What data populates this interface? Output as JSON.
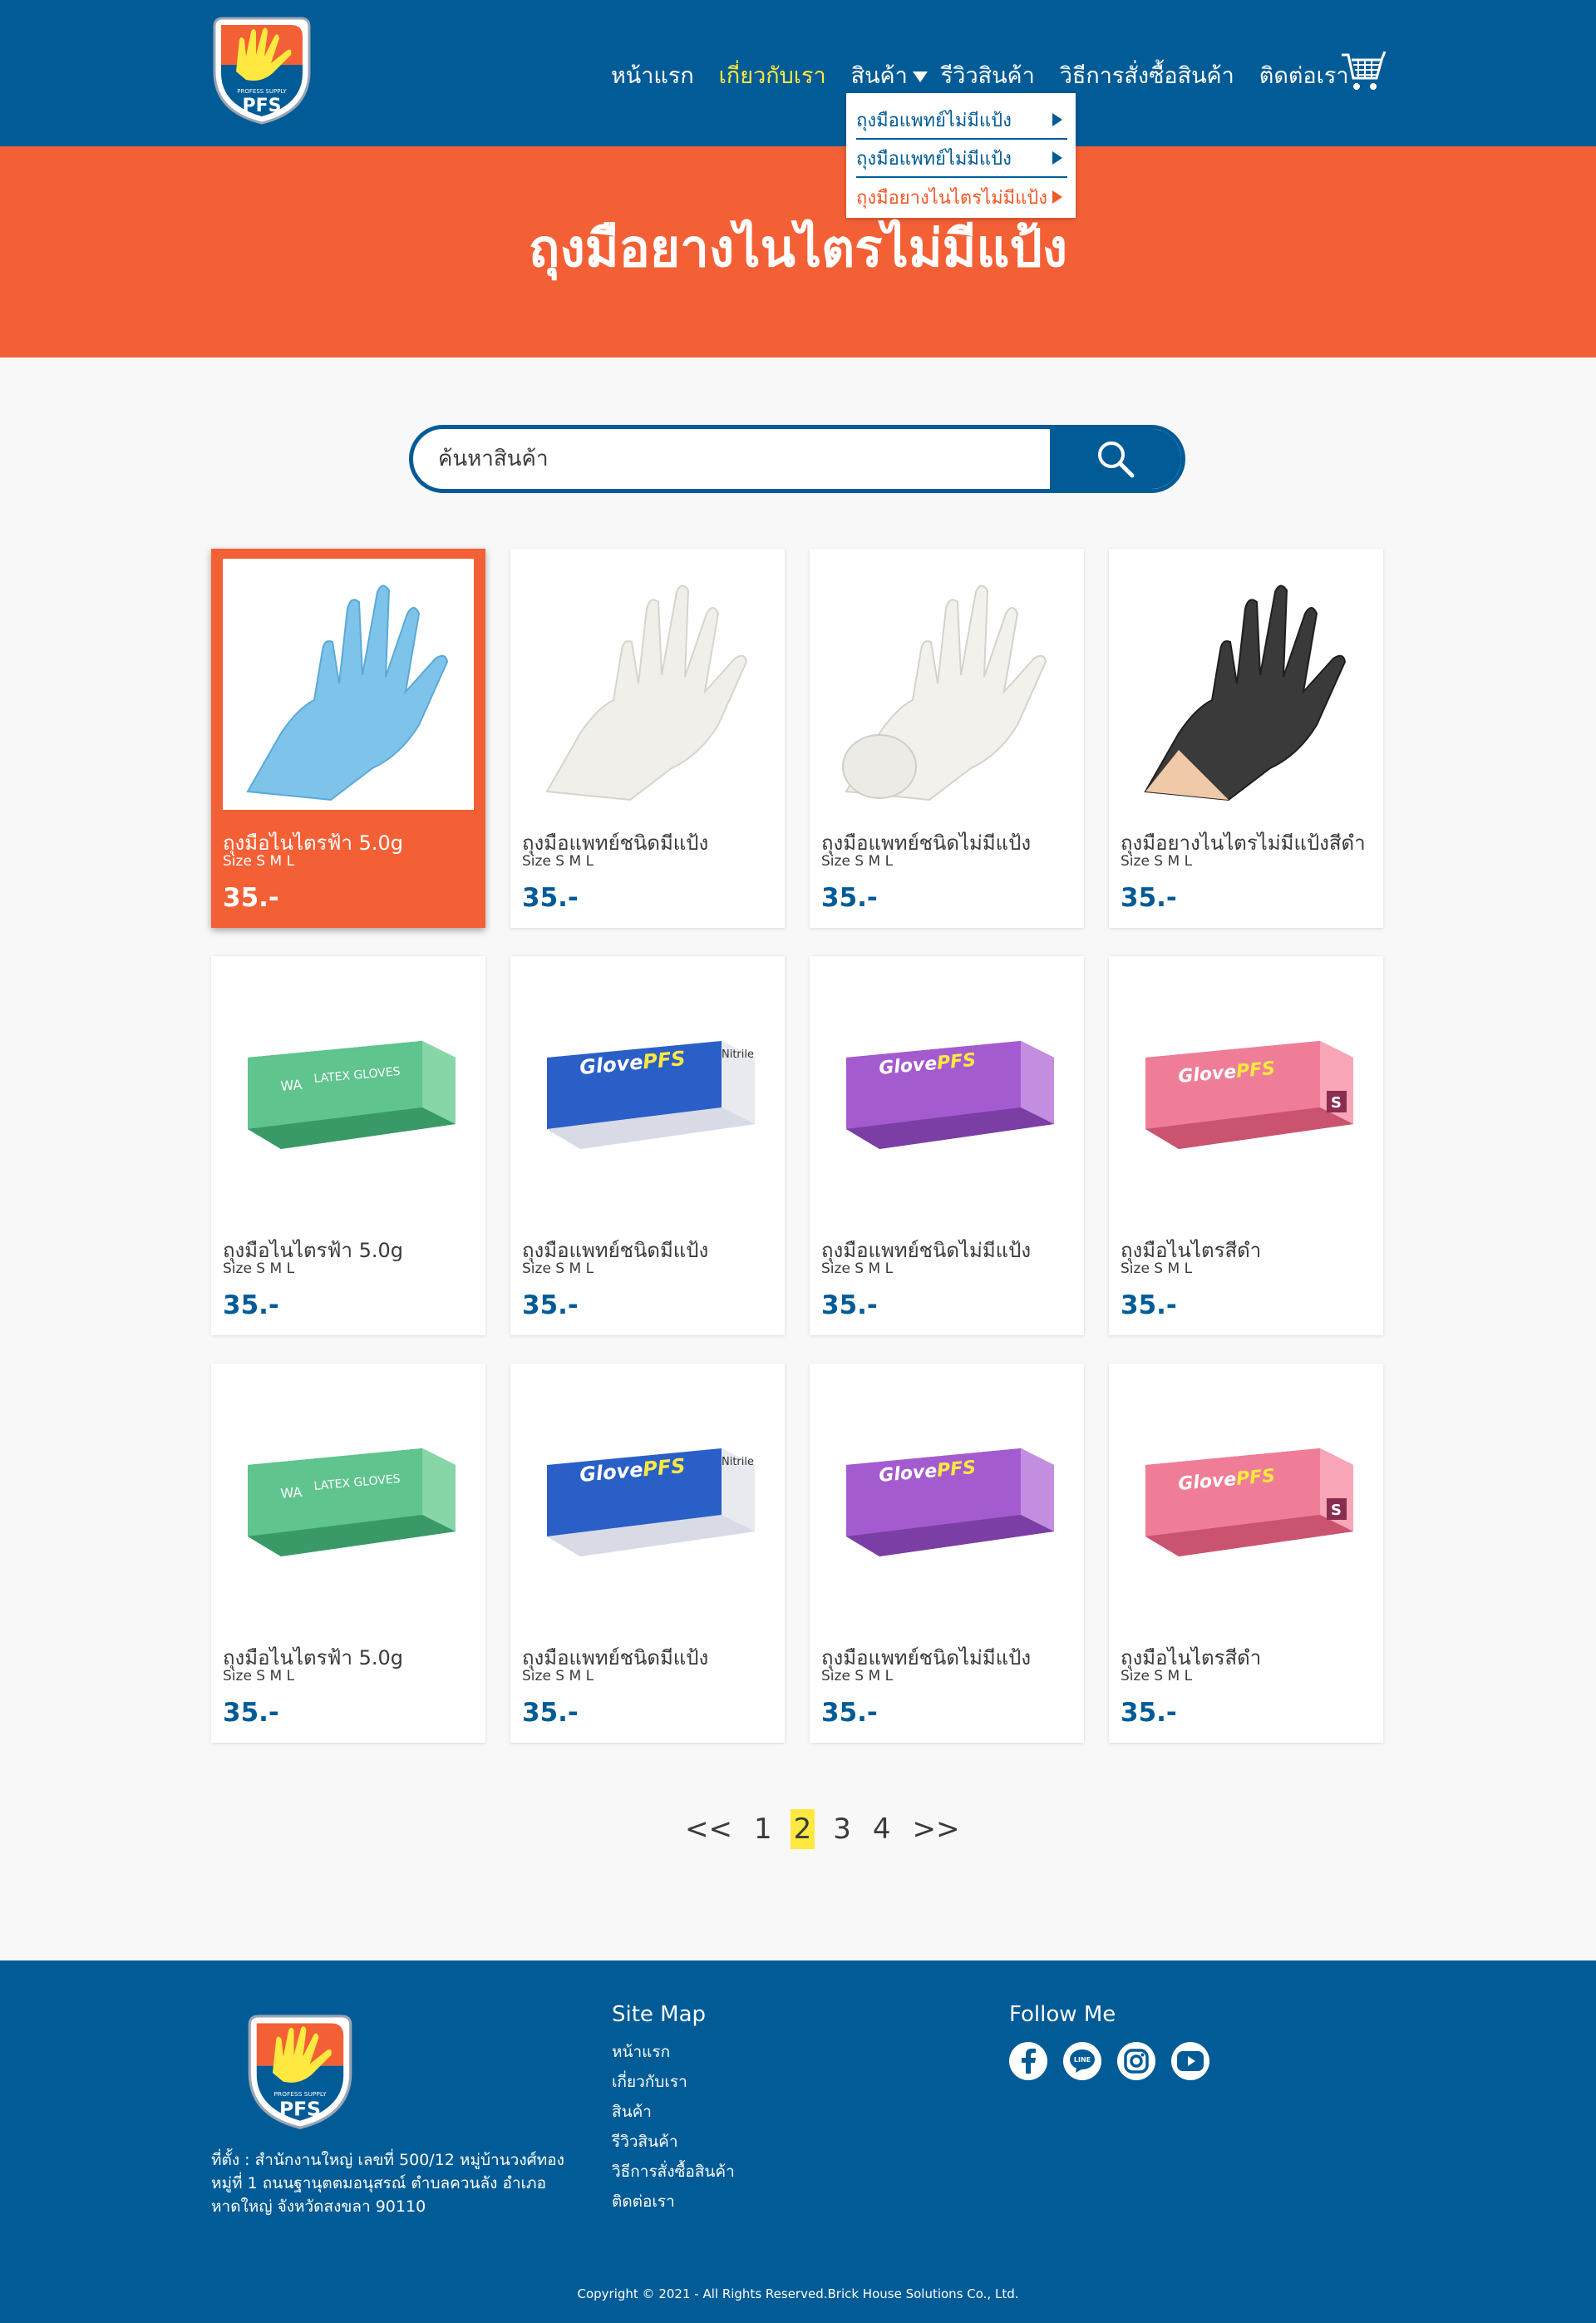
{
  "header": {
    "logo_text": "PFS",
    "logo_tagline": "PROFESS SUPPLY",
    "nav": [
      {
        "label": "หน้าแรก"
      },
      {
        "label": "เกี่ยวกับเรา"
      },
      {
        "label": "สินค้า"
      },
      {
        "label": "รีวิวสินค้า"
      },
      {
        "label": "วิธีการสั่งซื้อสินค้า"
      },
      {
        "label": "ติดต่อเรา"
      }
    ],
    "active_nav": "เกี่ยวกับเรา",
    "dropdown": [
      {
        "label": "ถุงมือแพทย์ไม่มีแป้ง"
      },
      {
        "label": "ถุงมือแพทย์ไม่มีแป้ง"
      },
      {
        "label": "ถุงมือยางไนไตรไม่มีแป้ง"
      }
    ]
  },
  "banner": {
    "title": "ถุงมือยางไนไตรไม่มีแป้ง"
  },
  "search": {
    "placeholder": "ค้นหาสินค้า"
  },
  "products": [
    {
      "name": "ถุงมือไนไตรฟ้า 5.0g",
      "size": "Size S M L",
      "price": "35.-",
      "image": "blue-glove"
    },
    {
      "name": "ถุงมือแพทย์ชนิดมีแป้ง",
      "size": "Size S M L",
      "price": "35.-",
      "image": "white-glove"
    },
    {
      "name": "ถุงมือแพทย์ชนิดไม่มีแป้ง",
      "size": "Size S M L",
      "price": "35.-",
      "image": "white-glove-hands"
    },
    {
      "name": "ถุงมือยางไนไตรไม่มีแป้งสีดำ",
      "size": "Size S M L",
      "price": "35.-",
      "image": "black-glove"
    },
    {
      "name": "ถุงมือไนไตรฟ้า 5.0g",
      "size": "Size S M L",
      "price": "35.-",
      "image": "green-box"
    },
    {
      "name": "ถุงมือแพทย์ชนิดมีแป้ง",
      "size": "Size S M L",
      "price": "35.-",
      "image": "blue-box"
    },
    {
      "name": "ถุงมือแพทย์ชนิดไม่มีแป้ง",
      "size": "Size S M L",
      "price": "35.-",
      "image": "purple-box"
    },
    {
      "name": "ถุงมือไนไตรสีดำ",
      "size": "Size S M L",
      "price": "35.-",
      "image": "pink-box"
    },
    {
      "name": "ถุงมือไนไตรฟ้า 5.0g",
      "size": "Size S M L",
      "price": "35.-",
      "image": "green-box"
    },
    {
      "name": "ถุงมือแพทย์ชนิดมีแป้ง",
      "size": "Size S M L",
      "price": "35.-",
      "image": "blue-box"
    },
    {
      "name": "ถุงมือแพทย์ชนิดไม่มีแป้ง",
      "size": "Size S M L",
      "price": "35.-",
      "image": "purple-box"
    },
    {
      "name": "ถุงมือไนไตรสีดำ",
      "size": "Size S M L",
      "price": "35.-",
      "image": "pink-box"
    }
  ],
  "box_labels": {
    "glove": "Glove",
    "pfs": "PFS",
    "green_brand": "WA",
    "green_title": "LATEX GLOVES",
    "nitrile": "Nitrile",
    "size_s": "S"
  },
  "pagination": {
    "prev": "<<",
    "pages": [
      "1",
      "2",
      "3",
      "4"
    ],
    "current": "2",
    "next": ">>"
  },
  "footer": {
    "address": "ที่ตั้ง : สำนักงานใหญ่ เลขที่ 500/12 หมู่บ้านวงศ์ทอง หมู่ที่ 1 ถนนฐานุตตมอนุสรณ์ ตำบลควนลัง อำเภอหาดใหญ่ จังหวัดสงขลา 90110",
    "sitemap_title": "Site Map",
    "sitemap": [
      "หน้าแรก",
      "เกี่ยวกับเรา",
      "สินค้า",
      "รีวิวสินค้า",
      "วิธีการสั่งซื้อสินค้า",
      "ติดต่อเรา"
    ],
    "follow_title": "Follow Me",
    "social": [
      "facebook-icon",
      "line-icon",
      "instagram-icon",
      "youtube-icon"
    ],
    "line_label": "LINE",
    "copyright": "Copyright © 2021 -  All Rights Reserved.Brick House Solutions Co., Ltd."
  },
  "colors": {
    "primary": "#005b96",
    "accent": "#f46036",
    "highlight": "#ffe940"
  }
}
